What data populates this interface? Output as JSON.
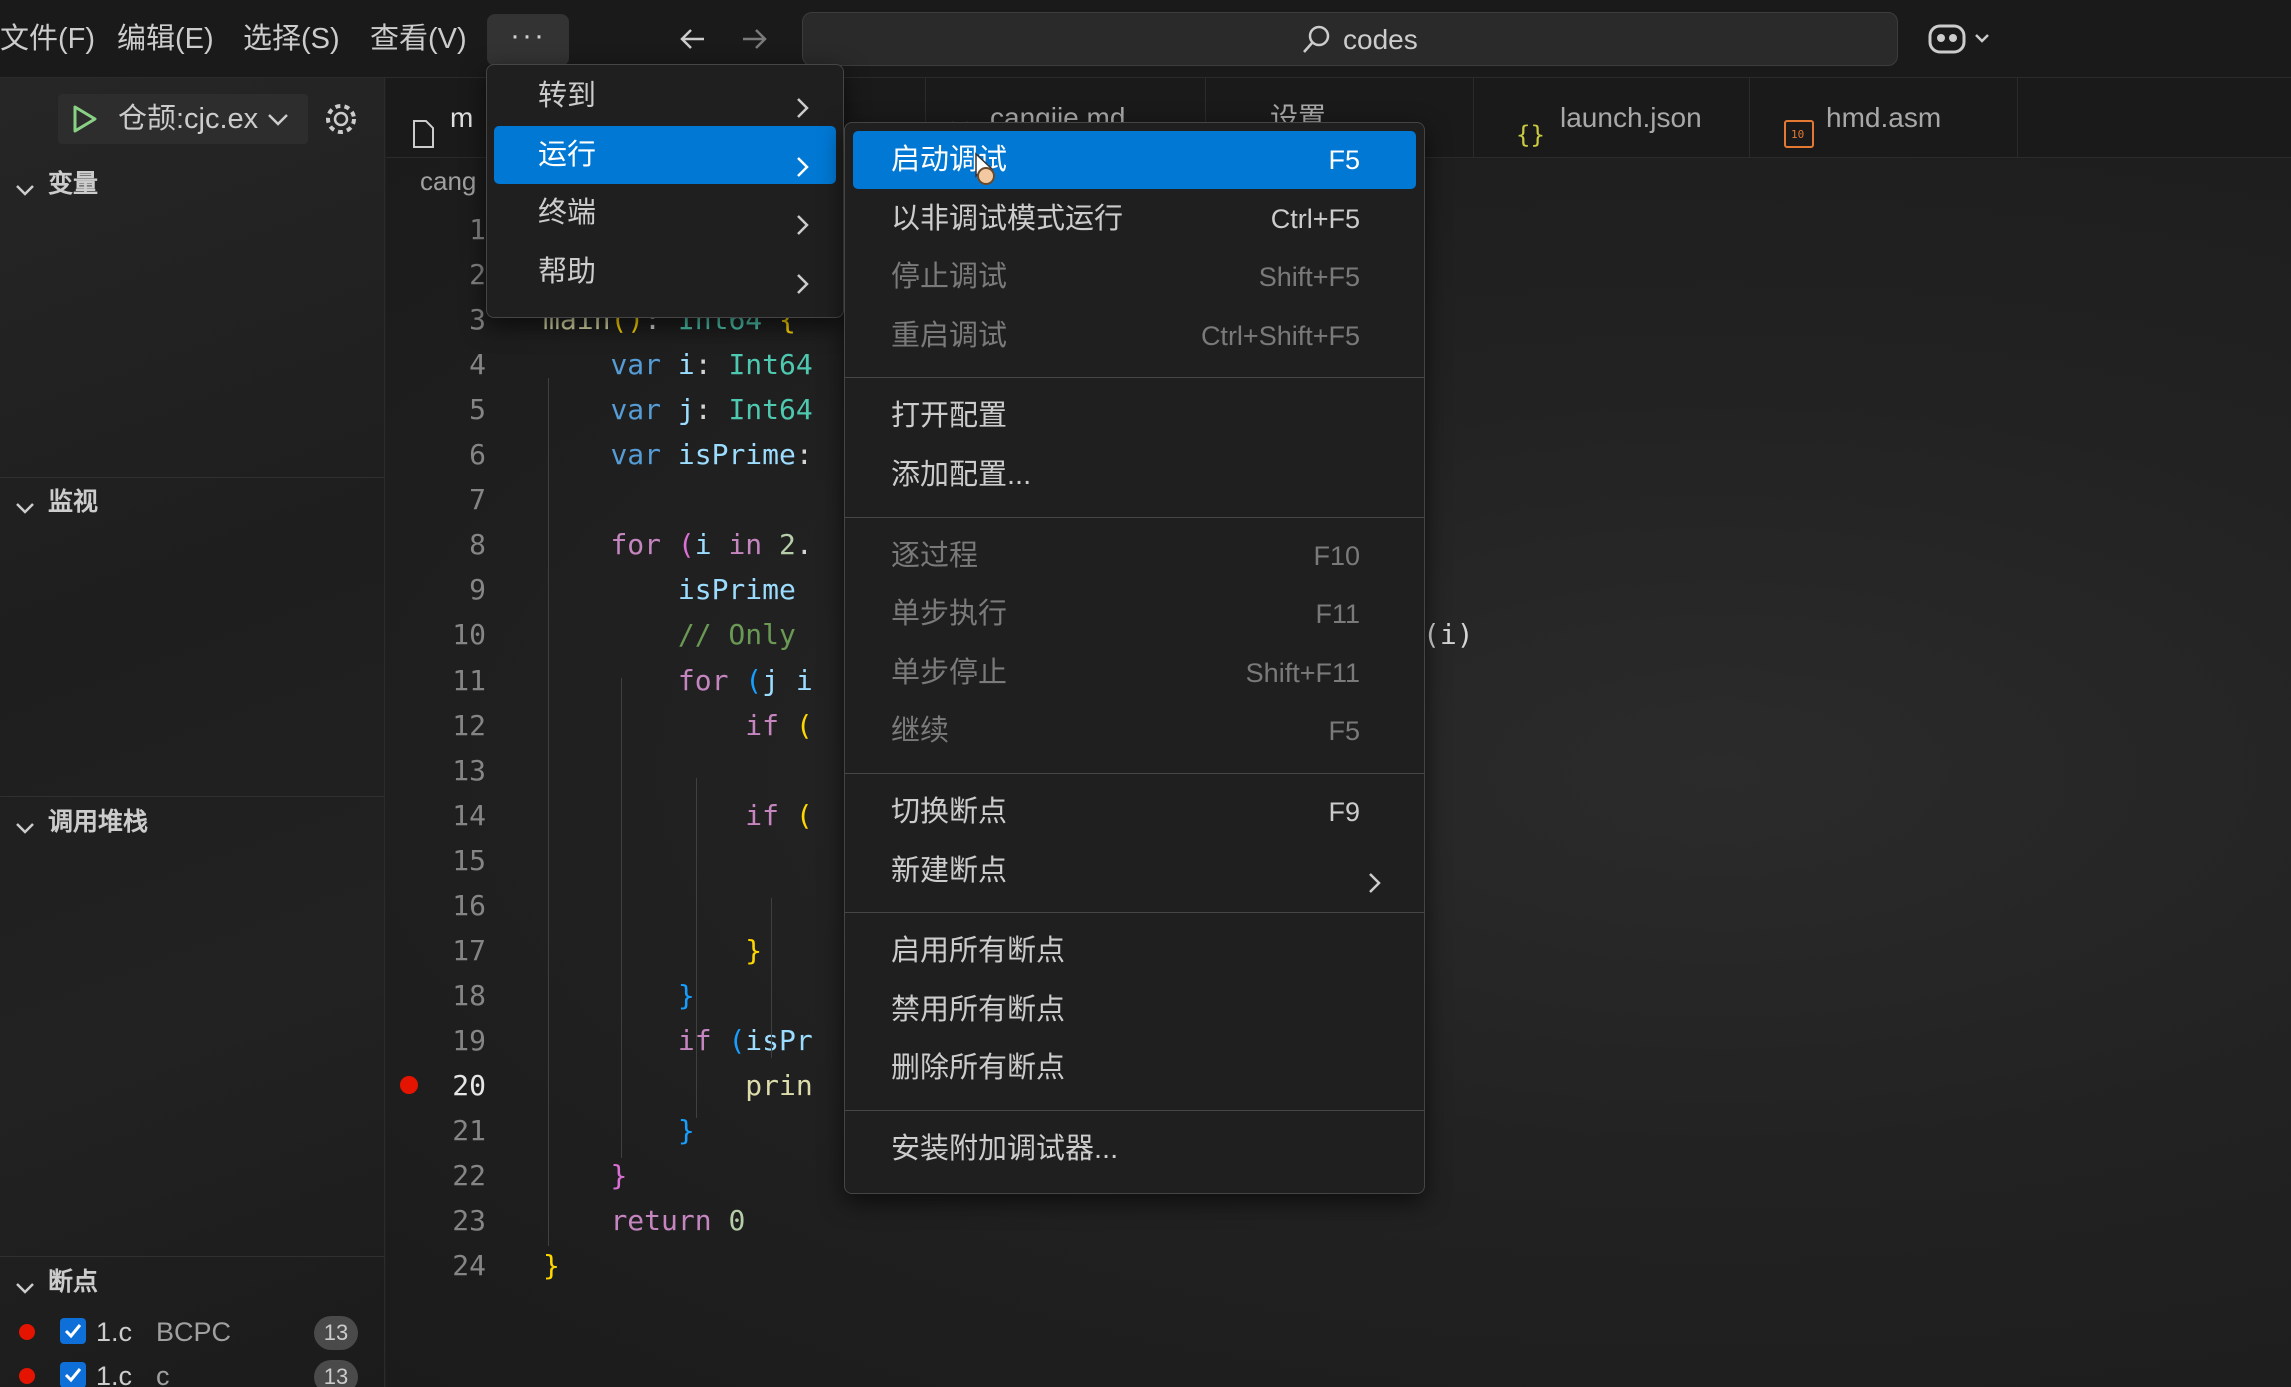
{
  "menubar": {
    "items": [
      "文件(F)",
      "编辑(E)",
      "选择(S)",
      "查看(V)"
    ],
    "more": "···"
  },
  "search": {
    "text": "codes"
  },
  "debug": {
    "config": "仓颉:cjc.ex"
  },
  "sidebar": {
    "sections": [
      "变量",
      "监视",
      "调用堆栈",
      "断点"
    ],
    "breakpoints": [
      {
        "file": "1.c",
        "func": "BCPC",
        "count": "13"
      },
      {
        "file": "1.c",
        "func": "c",
        "count": "13"
      }
    ]
  },
  "tabs": [
    {
      "label": "m",
      "icon": "file-icon"
    },
    {
      "label": "cangjie.md",
      "icon": "markdown-icon"
    },
    {
      "label": "设置",
      "icon": "settings-icon"
    },
    {
      "label": "launch.json",
      "icon": "json-icon"
    },
    {
      "label": "hmd.asm",
      "icon": "binary-icon"
    }
  ],
  "editor": {
    "breadcrumb": "cang",
    "lines": [
      {
        "n": "1",
        "code": ""
      },
      {
        "n": "2",
        "code": ""
      },
      {
        "n": "3",
        "code": "main(): Int64 {"
      },
      {
        "n": "4",
        "code": "    var i: Int64"
      },
      {
        "n": "5",
        "code": "    var j: Int64"
      },
      {
        "n": "6",
        "code": "    var isPrime:"
      },
      {
        "n": "7",
        "code": ""
      },
      {
        "n": "8",
        "code": "    for (i in 2."
      },
      {
        "n": "9",
        "code": "        isPrime"
      },
      {
        "n": "10",
        "code": "        // Only"
      },
      {
        "n": "11",
        "code": "        for (j i"
      },
      {
        "n": "12",
        "code": "            if ("
      },
      {
        "n": "13",
        "code": ""
      },
      {
        "n": "14",
        "code": "            if ("
      },
      {
        "n": "15",
        "code": ""
      },
      {
        "n": "16",
        "code": ""
      },
      {
        "n": "17",
        "code": "            }"
      },
      {
        "n": "18",
        "code": "        }"
      },
      {
        "n": "19",
        "code": "        if (isPr"
      },
      {
        "n": "20",
        "code": "            prin"
      },
      {
        "n": "21",
        "code": "        }"
      },
      {
        "n": "22",
        "code": "    }"
      },
      {
        "n": "23",
        "code": "    return 0"
      },
      {
        "n": "24",
        "code": "}"
      }
    ],
    "right_fragment": "(i)",
    "active_line": "20"
  },
  "more_menu": {
    "items": [
      {
        "label": "转到",
        "selected": false
      },
      {
        "label": "运行",
        "selected": true
      },
      {
        "label": "终端",
        "selected": false
      },
      {
        "label": "帮助",
        "selected": false
      }
    ]
  },
  "run_menu": {
    "groups": [
      [
        {
          "label": "启动调试",
          "key": "F5",
          "state": "selected"
        },
        {
          "label": "以非调试模式运行",
          "key": "Ctrl+F5",
          "state": "enabled"
        },
        {
          "label": "停止调试",
          "key": "Shift+F5",
          "state": "disabled"
        },
        {
          "label": "重启调试",
          "key": "Ctrl+Shift+F5",
          "state": "disabled"
        }
      ],
      [
        {
          "label": "打开配置",
          "key": "",
          "state": "enabled"
        },
        {
          "label": "添加配置...",
          "key": "",
          "state": "enabled"
        }
      ],
      [
        {
          "label": "逐过程",
          "key": "F10",
          "state": "disabled"
        },
        {
          "label": "单步执行",
          "key": "F11",
          "state": "disabled"
        },
        {
          "label": "单步停止",
          "key": "Shift+F11",
          "state": "disabled"
        },
        {
          "label": "继续",
          "key": "F5",
          "state": "disabled"
        }
      ],
      [
        {
          "label": "切换断点",
          "key": "F9",
          "state": "enabled"
        },
        {
          "label": "新建断点",
          "key": "",
          "state": "enabled",
          "submenu": true
        }
      ],
      [
        {
          "label": "启用所有断点",
          "key": "",
          "state": "enabled"
        },
        {
          "label": "禁用所有断点",
          "key": "",
          "state": "enabled"
        },
        {
          "label": "删除所有断点",
          "key": "",
          "state": "enabled"
        }
      ],
      [
        {
          "label": "安装附加调试器...",
          "key": "",
          "state": "enabled"
        }
      ]
    ]
  },
  "colors": {
    "accent": "#0078d4",
    "breakpoint": "#e51400",
    "keyword": "#c586c0",
    "type": "#4ec9b0",
    "variable": "#9cdcfe",
    "function": "#dcdcaa",
    "comment": "#6a9955",
    "number": "#b5cea8",
    "bracket_yellow": "#ffd700",
    "bracket_blue": "#179fff",
    "bracket_pink": "#da70d6"
  }
}
